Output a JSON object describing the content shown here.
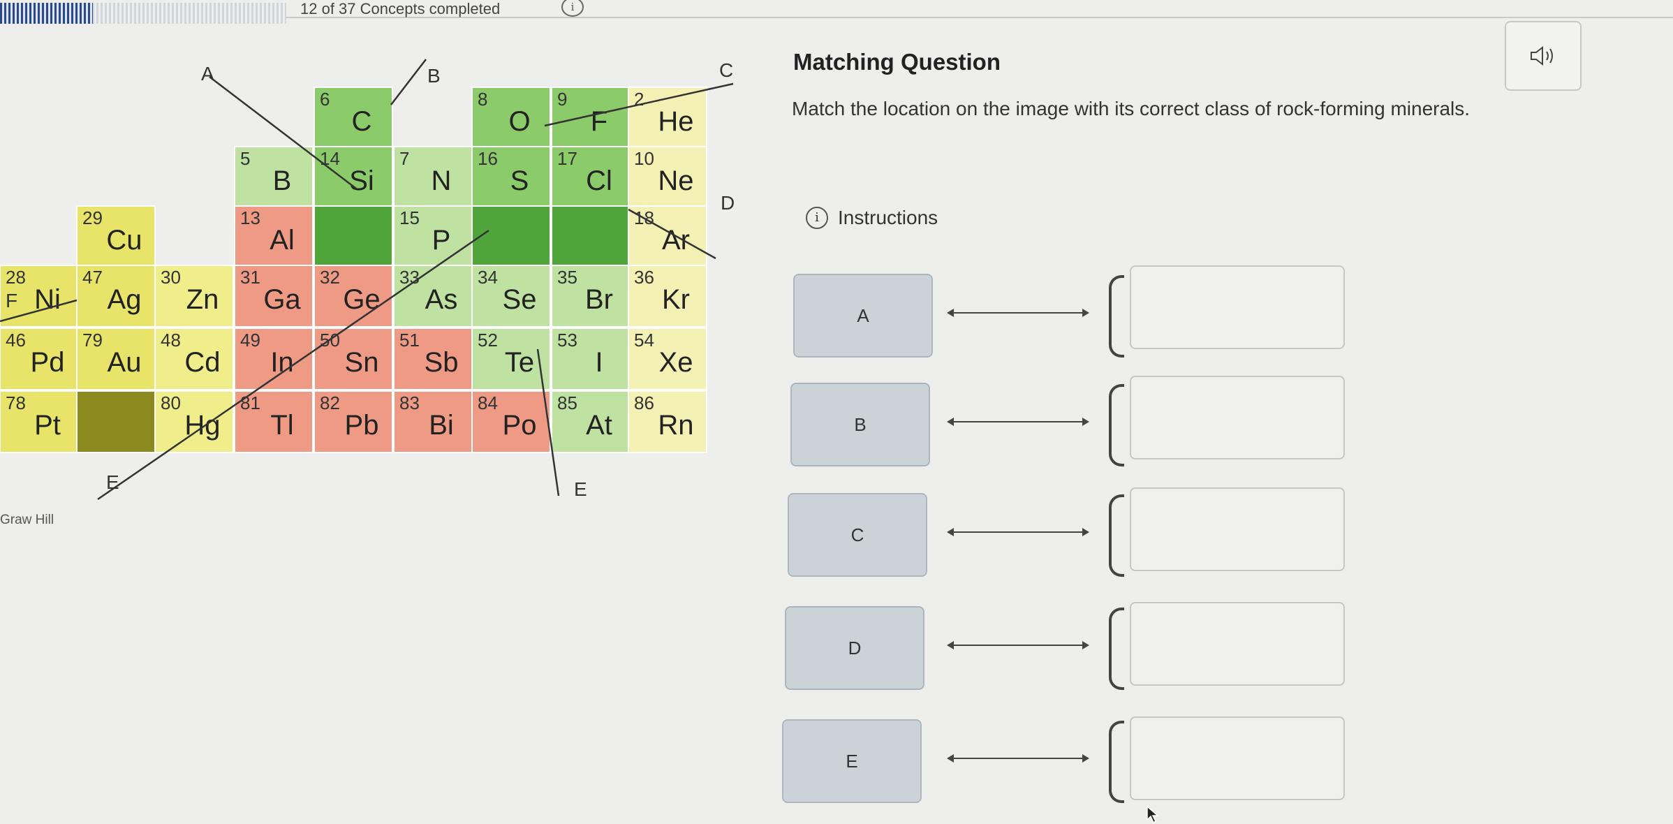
{
  "header": {
    "progress_text": "12 of 37 Concepts completed",
    "progress_fraction": 0.3243,
    "info_icon": "info-icon"
  },
  "figure": {
    "credit": "Graw Hill",
    "line_labels": [
      "A",
      "B",
      "C",
      "D",
      "E",
      "F"
    ],
    "cells": [
      {
        "num": "6",
        "sym": "C",
        "color": "#8ccb6a"
      },
      {
        "num": "8",
        "sym": "O",
        "color": "#8ccb6a"
      },
      {
        "num": "9",
        "sym": "F",
        "color": "#8ccb6a"
      },
      {
        "num": "2",
        "sym": "He",
        "color": "#f4f1b4"
      },
      {
        "num": "5",
        "sym": "B",
        "color": "#bfe2a2"
      },
      {
        "num": "14",
        "sym": "Si",
        "color": "#8ccb6a"
      },
      {
        "num": "7",
        "sym": "N",
        "color": "#bfe2a2"
      },
      {
        "num": "16",
        "sym": "S",
        "color": "#8ccb6a"
      },
      {
        "num": "17",
        "sym": "Cl",
        "color": "#8ccb6a"
      },
      {
        "num": "10",
        "sym": "Ne",
        "color": "#f4f1b4"
      },
      {
        "num": "13",
        "sym": "Al",
        "color": "#ee9a84"
      },
      {
        "num": "",
        "sym": "",
        "color": "#4fa53a"
      },
      {
        "num": "15",
        "sym": "P",
        "color": "#bfe2a2"
      },
      {
        "num": "",
        "sym": "",
        "color": "#4fa53a"
      },
      {
        "num": "",
        "sym": "",
        "color": "#4fa53a"
      },
      {
        "num": "18",
        "sym": "Ar",
        "color": "#f4f1b4"
      },
      {
        "num": "29",
        "sym": "Cu",
        "color": "#e7e469"
      },
      {
        "num": "28",
        "sym": "Ni",
        "color": "#e7e469"
      },
      {
        "num": "47",
        "sym": "Ag",
        "color": "#e7e469"
      },
      {
        "num": "30",
        "sym": "Zn",
        "color": "#f0ee8a"
      },
      {
        "num": "31",
        "sym": "Ga",
        "color": "#ee9a84"
      },
      {
        "num": "32",
        "sym": "Ge",
        "color": "#ee9a84"
      },
      {
        "num": "33",
        "sym": "As",
        "color": "#bfe2a2"
      },
      {
        "num": "34",
        "sym": "Se",
        "color": "#bfe2a2"
      },
      {
        "num": "35",
        "sym": "Br",
        "color": "#bfe2a2"
      },
      {
        "num": "36",
        "sym": "Kr",
        "color": "#f4f1b4"
      },
      {
        "num": "46",
        "sym": "Pd",
        "color": "#e7e469"
      },
      {
        "num": "79",
        "sym": "Au",
        "color": "#e7e469"
      },
      {
        "num": "48",
        "sym": "Cd",
        "color": "#f0ee8a"
      },
      {
        "num": "49",
        "sym": "In",
        "color": "#ee9a84"
      },
      {
        "num": "50",
        "sym": "Sn",
        "color": "#ee9a84"
      },
      {
        "num": "51",
        "sym": "Sb",
        "color": "#ee9a84"
      },
      {
        "num": "52",
        "sym": "Te",
        "color": "#bfe2a2"
      },
      {
        "num": "53",
        "sym": "I",
        "color": "#bfe2a2"
      },
      {
        "num": "54",
        "sym": "Xe",
        "color": "#f4f1b4"
      },
      {
        "num": "78",
        "sym": "Pt",
        "color": "#e7e469"
      },
      {
        "num": "",
        "sym": "",
        "color": "#8a8a1e"
      },
      {
        "num": "80",
        "sym": "Hg",
        "color": "#f0ee8a"
      },
      {
        "num": "81",
        "sym": "Tl",
        "color": "#ee9a84"
      },
      {
        "num": "82",
        "sym": "Pb",
        "color": "#ee9a84"
      },
      {
        "num": "83",
        "sym": "Bi",
        "color": "#ee9a84"
      },
      {
        "num": "84",
        "sym": "Po",
        "color": "#ee9a84"
      },
      {
        "num": "85",
        "sym": "At",
        "color": "#bfe2a2"
      },
      {
        "num": "86",
        "sym": "Rn",
        "color": "#f4f1b4"
      }
    ]
  },
  "question": {
    "title": "Matching Question",
    "prompt": "Match the location on the image with its correct class of rock-forming minerals.",
    "instructions_label": "Instructions",
    "speaker_icon": "speaker-icon",
    "items": [
      {
        "label": "A",
        "answer": ""
      },
      {
        "label": "B",
        "answer": ""
      },
      {
        "label": "C",
        "answer": ""
      },
      {
        "label": "D",
        "answer": ""
      },
      {
        "label": "E",
        "answer": ""
      }
    ]
  }
}
